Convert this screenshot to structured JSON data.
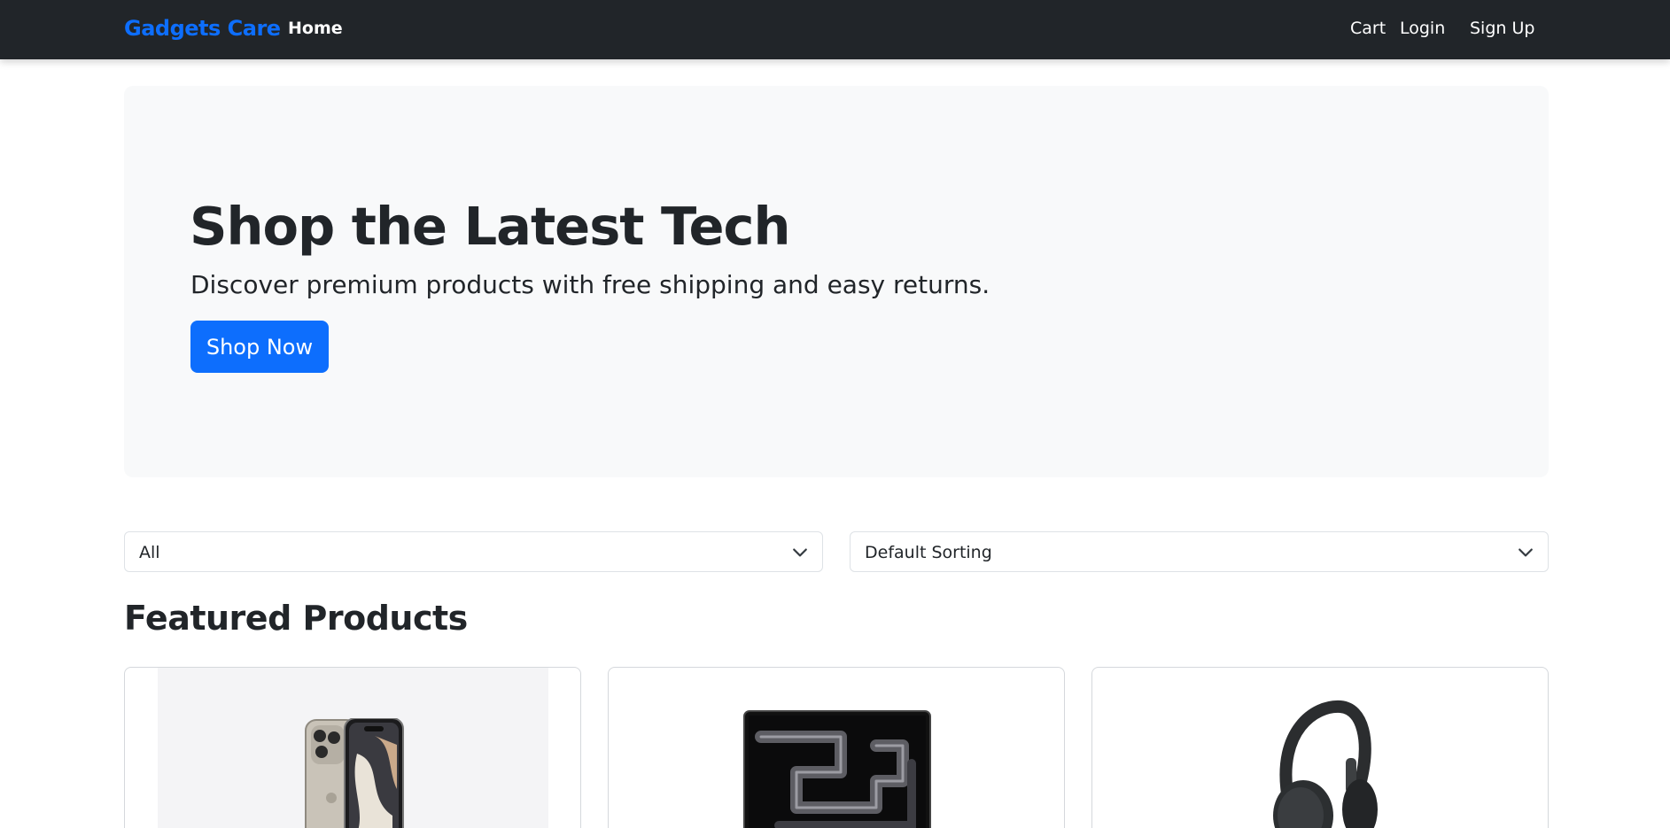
{
  "navbar": {
    "brand": "Gadgets Care",
    "home": "Home",
    "cart": "Cart",
    "login": "Login",
    "signup": "Sign Up"
  },
  "hero": {
    "title": "Shop the Latest Tech",
    "subtitle": "Discover premium products with free shipping and easy returns.",
    "button": "Shop Now"
  },
  "filters": {
    "category": "All",
    "sort": "Default Sorting"
  },
  "section": {
    "title": "Featured Products"
  },
  "products": [
    {
      "icon": "smartphone-image"
    },
    {
      "icon": "laptop-image"
    },
    {
      "icon": "headphones-image"
    }
  ],
  "colors": {
    "navbar_bg": "#212529",
    "brand": "#0d6efd",
    "hero_bg": "#f8f9fa",
    "primary_button": "#0d6efd"
  }
}
